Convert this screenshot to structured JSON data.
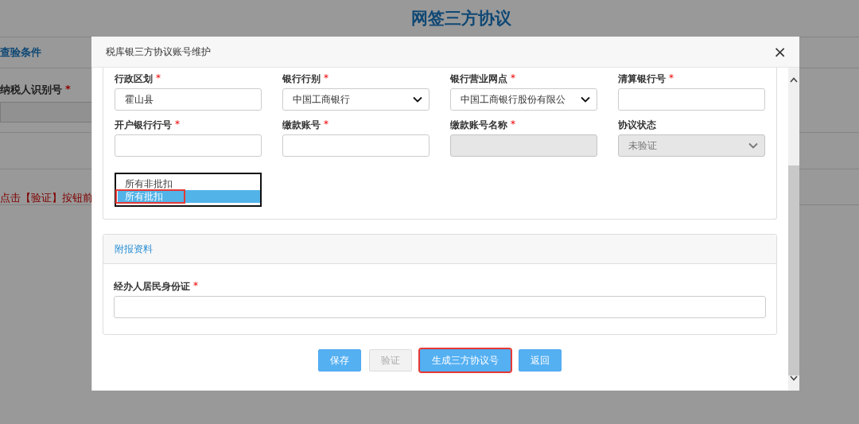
{
  "required_mark": "*",
  "page": {
    "title": "网签三方协议",
    "section_title": "查验条件",
    "taxpayer_id_label": "纳税人识别号",
    "taxpayer_id_required": true,
    "notice": "点击【验证】按钮前"
  },
  "dialog": {
    "title": "税库银三方协议账号维护",
    "close": "×",
    "fields": [
      {
        "label": "行政区划",
        "required": true,
        "kind": "input",
        "value": "霍山县",
        "disabled": false
      },
      {
        "label": "银行行别",
        "required": true,
        "kind": "select",
        "value": "中国工商银行",
        "disabled": false
      },
      {
        "label": "银行营业网点",
        "required": true,
        "kind": "select",
        "value": "中国工商银行股份有限公",
        "disabled": false
      },
      {
        "label": "清算银行号",
        "required": true,
        "kind": "input",
        "disabled": false
      },
      {
        "label": "开户银行行号",
        "required": true,
        "kind": "input",
        "disabled": false
      },
      {
        "label": "缴款账号",
        "required": true,
        "kind": "input",
        "disabled": false
      },
      {
        "label": "缴款账号名称",
        "required": true,
        "kind": "input",
        "disabled": true
      },
      {
        "label": "协议状态",
        "required": false,
        "kind": "select",
        "value": "未验证",
        "disabled": true
      }
    ],
    "dropdown_options": [
      {
        "label": "所有非批扣",
        "selected": false,
        "highlighted": false
      },
      {
        "label": "所有批扣",
        "selected": true,
        "highlighted": true
      }
    ],
    "attachments": {
      "title": "附报资料",
      "fields": [
        {
          "label": "经办人居民身份证",
          "required": true
        }
      ]
    },
    "buttons": [
      {
        "label": "保存",
        "disabled": false,
        "highlighted": false
      },
      {
        "label": "验证",
        "disabled": true,
        "highlighted": false
      },
      {
        "label": "生成三方协议号",
        "disabled": false,
        "highlighted": true
      },
      {
        "label": "返回",
        "disabled": false,
        "highlighted": false
      }
    ]
  }
}
